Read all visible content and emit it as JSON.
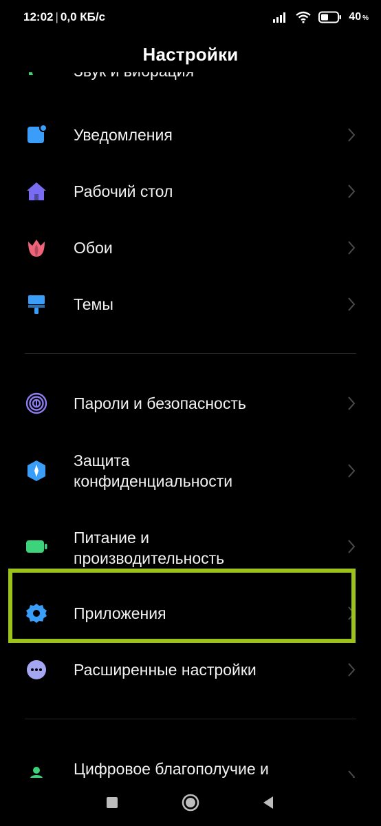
{
  "status_bar": {
    "time": "12:02",
    "separator": "|",
    "net_speed": "0,0 КБ/с",
    "battery_value": "40",
    "battery_unit": "%"
  },
  "header": {
    "title": "Настройки"
  },
  "list": {
    "cut_item_label": "Звук и вибрация",
    "items": [
      {
        "label": "Уведомления",
        "icon": "notification-icon"
      },
      {
        "label": "Рабочий стол",
        "icon": "home-icon"
      },
      {
        "label": "Обои",
        "icon": "tulip-icon"
      },
      {
        "label": "Темы",
        "icon": "brush-icon"
      },
      {
        "label": "Пароли и безопасность",
        "icon": "fingerprint-icon"
      },
      {
        "label_line1": "Защита",
        "label_line2": "конфиденциальности",
        "icon": "privacy-shield-icon"
      },
      {
        "label_line1": "Питание и",
        "label_line2": "производительность",
        "icon": "battery-icon"
      },
      {
        "label": "Приложения",
        "icon": "gear-icon"
      },
      {
        "label": "Расширенные настройки",
        "icon": "more-icon"
      },
      {
        "label": "Цифровое благополучие и",
        "icon": "person-icon"
      }
    ]
  },
  "colors": {
    "background": "#000000",
    "highlight": "#9bc31c",
    "notification": "#3a9df8",
    "home": "#7a6cf0",
    "tulip": "#f0647a",
    "brush": "#3a9df8",
    "fingerprint": "#8c7cf0",
    "privacy": "#3a9df8",
    "battery": "#3cd37a",
    "gear": "#3a9df8",
    "more": "#a4a6f2",
    "person": "#3cd37a"
  }
}
